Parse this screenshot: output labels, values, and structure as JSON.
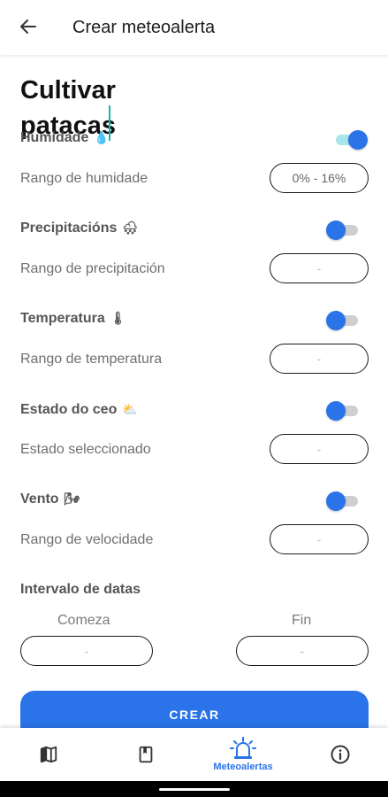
{
  "header": {
    "title": "Crear meteoalerta",
    "back_icon": "arrow-left-icon"
  },
  "form": {
    "name": "Cultivar patacas",
    "sections": [
      {
        "label": "Humidade",
        "emoji": "💧",
        "enabled": true,
        "row_label": "Rango de humidade",
        "value": "0% - 16%"
      },
      {
        "label": "Precipitacións",
        "emoji": "🌨",
        "enabled": false,
        "row_label": "Rango de precipitación",
        "value": "-"
      },
      {
        "label": "Temperatura",
        "emoji": "🌡",
        "enabled": false,
        "row_label": "Rango de temperatura",
        "value": "-"
      },
      {
        "label": "Estado do ceo",
        "emoji": "⛅",
        "enabled": false,
        "row_label": "Estado seleccionado",
        "value": "-"
      },
      {
        "label": "Vento",
        "emoji": "🌬",
        "enabled": false,
        "row_label": "Rango de velocidade",
        "value": "-"
      }
    ],
    "date_interval": {
      "label": "Intervalo de datas",
      "start_label": "Comeza",
      "start_value": "-",
      "end_label": "Fin",
      "end_value": "-"
    },
    "submit_label": "CREAR"
  },
  "bottom_nav": [
    {
      "icon": "map-icon",
      "label": ""
    },
    {
      "icon": "book-icon",
      "label": ""
    },
    {
      "icon": "alarm-light-icon",
      "label": "Meteoalertas",
      "active": true
    },
    {
      "icon": "info-icon",
      "label": ""
    }
  ],
  "colors": {
    "accent": "#2a73e8",
    "toggle_track_on": "#a9e6e8",
    "toggle_track_off": "#cfcfcf"
  }
}
